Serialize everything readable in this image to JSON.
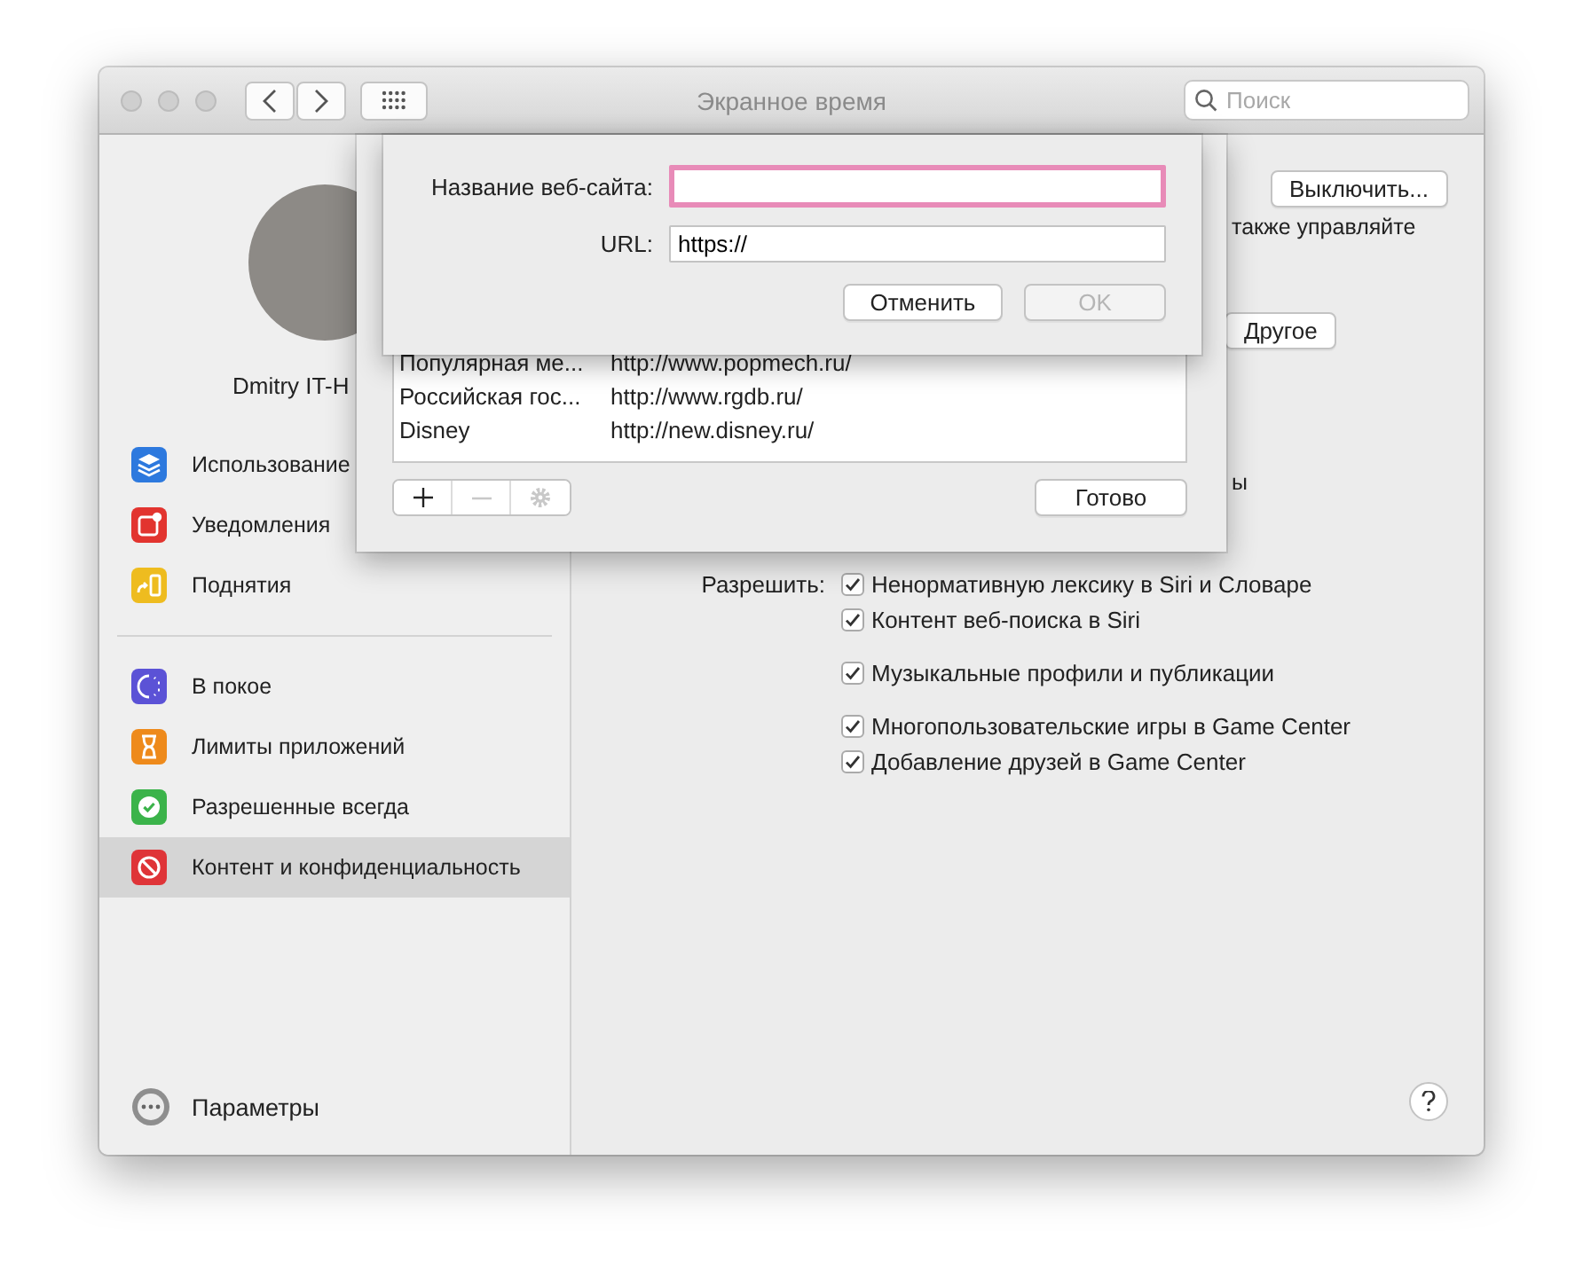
{
  "window": {
    "title": "Экранное время",
    "search": {
      "placeholder": "Поиск"
    }
  },
  "sidebar": {
    "user_name": "Dmitry IT-H",
    "groups": [
      [
        {
          "label": "Использование",
          "kind": "layers",
          "selected": false
        },
        {
          "label": "Уведомления",
          "kind": "notification",
          "selected": false
        },
        {
          "label": "Поднятия",
          "kind": "pickup",
          "selected": false
        }
      ],
      [
        {
          "label": "В покое",
          "kind": "downtime",
          "selected": false
        },
        {
          "label": "Лимиты приложений",
          "kind": "hourglass",
          "selected": false
        },
        {
          "label": "Разрешенные всегда",
          "kind": "allowed",
          "selected": false
        },
        {
          "label": "Контент и конфиденциальность",
          "kind": "blocked",
          "selected": true
        }
      ]
    ],
    "footer": "Параметры"
  },
  "content": {
    "turn_off_button": "Выключить...",
    "hint_fragment": "также управляйте",
    "other_button": "Другое",
    "cut_fragment": "ы",
    "allow": {
      "label": "Разрешить:",
      "groups": [
        [
          {
            "label": "Ненормативную лексику в Siri и Словаре",
            "checked": true
          },
          {
            "label": "Контент веб-поиска в Siri",
            "checked": true
          }
        ],
        [
          {
            "label": "Музыкальные профили и публикации",
            "checked": true
          }
        ],
        [
          {
            "label": "Многопользовательские игры в Game Center",
            "checked": true
          },
          {
            "label": "Добавление друзей в Game Center",
            "checked": true
          }
        ]
      ]
    }
  },
  "websites_sheet": {
    "rows": [
      {
        "name": "Популярная ме...",
        "url": "http://www.popmech.ru/"
      },
      {
        "name": "Российская гос...",
        "url": "http://www.rgdb.ru/"
      },
      {
        "name": "Disney",
        "url": "http://new.disney.ru/"
      }
    ],
    "done_button": "Готово"
  },
  "add_site_dialog": {
    "name_label": "Название веб-сайта:",
    "name_focused": true,
    "url_label": "URL:",
    "url_value": "https://",
    "cancel_button": "Отменить",
    "ok_button": {
      "label": "OK",
      "disabled": true
    }
  }
}
